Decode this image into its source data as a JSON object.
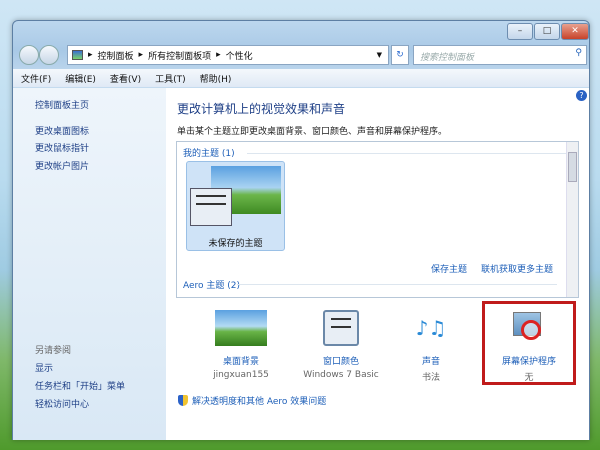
{
  "window": {
    "minimize": "–",
    "maximize": "□",
    "close": "✕"
  },
  "address": {
    "crumbs": [
      "控制面板",
      "所有控制面板项",
      "个性化"
    ]
  },
  "search": {
    "placeholder": "搜索控制面板"
  },
  "menu": [
    "文件(F)",
    "编辑(E)",
    "查看(V)",
    "工具(T)",
    "帮助(H)"
  ],
  "sidebar": {
    "top_link": "控制面板主页",
    "links": [
      "更改桌面图标",
      "更改鼠标指针",
      "更改帐户图片"
    ],
    "see_also": "另请参阅",
    "see_links": [
      "显示",
      "任务栏和「开始」菜单",
      "轻松访问中心"
    ]
  },
  "main": {
    "title": "更改计算机上的视觉效果和声音",
    "subtitle": "单击某个主题立即更改桌面背景、窗口颜色、声音和屏幕保护程序。",
    "my_themes": "我的主题 (1)",
    "unsaved_theme": "未保存的主题",
    "save_theme": "保存主题",
    "get_more": "联机获取更多主题",
    "aero_themes": "Aero 主题 (2)",
    "tiles": [
      {
        "label": "桌面背景",
        "value": "jingxuan155"
      },
      {
        "label": "窗口颜色",
        "value": "Windows 7 Basic"
      },
      {
        "label": "声音",
        "value": "书法"
      },
      {
        "label": "屏幕保护程序",
        "value": "无"
      }
    ],
    "aero_fix": "解决透明度和其他 Aero 效果问题",
    "help": "?"
  },
  "colors": {
    "highlight": "#c01b1b",
    "link": "#1e5fb8"
  }
}
